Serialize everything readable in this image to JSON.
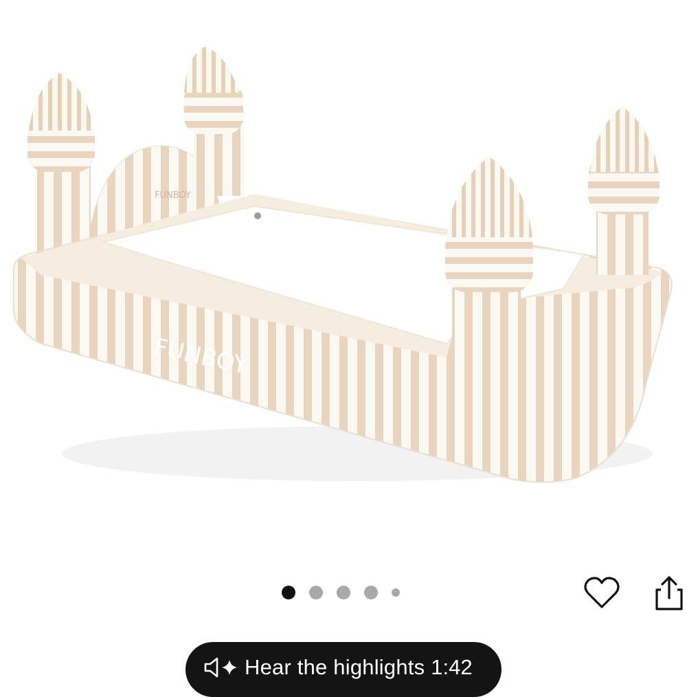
{
  "product_image": {
    "alt": "Inflatable castle toddler bed with beige and white stripes",
    "brand_text": "FUNBOY",
    "stripe_color": "#e9d5bf",
    "base_color": "#fbf7f1"
  },
  "carousel": {
    "dot_count": 5,
    "active_index": 0
  },
  "actions": {
    "wishlist_icon": "heart-outline-icon",
    "share_icon": "share-icon"
  },
  "audio_summary": {
    "label": "Hear the highlights",
    "duration": "1:42",
    "icon": "speaker-sparkle-icon"
  }
}
